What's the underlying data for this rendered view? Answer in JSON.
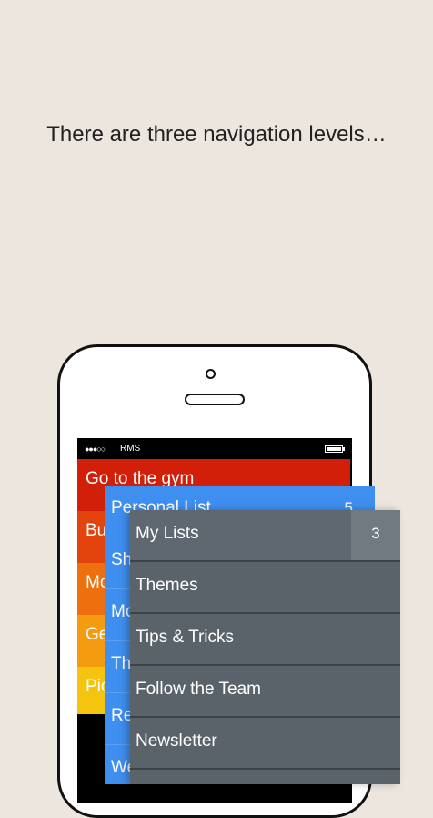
{
  "headline": "There are three navigation levels…",
  "status_bar": {
    "signal": "●●●○○",
    "carrier": "RMS",
    "battery_icon": "battery-icon"
  },
  "level1": {
    "items": [
      {
        "label": "Go to the gym",
        "color": "#d21f0a"
      },
      {
        "label": "Bu",
        "color": "#e3430c"
      },
      {
        "label": "Mc",
        "color": "#ee6f0e"
      },
      {
        "label": "Ge",
        "color": "#f49b10"
      },
      {
        "label": "Pic",
        "color": "#f5c40f"
      }
    ]
  },
  "level2": {
    "color": "#3f8ff0",
    "items": [
      {
        "label": "Personal List",
        "count": "5"
      },
      {
        "label": "Sh"
      },
      {
        "label": "Mc"
      },
      {
        "label": "Th"
      },
      {
        "label": "Re"
      },
      {
        "label": "We"
      }
    ]
  },
  "level3": {
    "color": "#5b636a",
    "items": [
      {
        "label": "My Lists",
        "count": "3"
      },
      {
        "label": "Themes"
      },
      {
        "label": "Tips & Tricks"
      },
      {
        "label": "Follow the Team"
      },
      {
        "label": "Newsletter"
      }
    ]
  }
}
